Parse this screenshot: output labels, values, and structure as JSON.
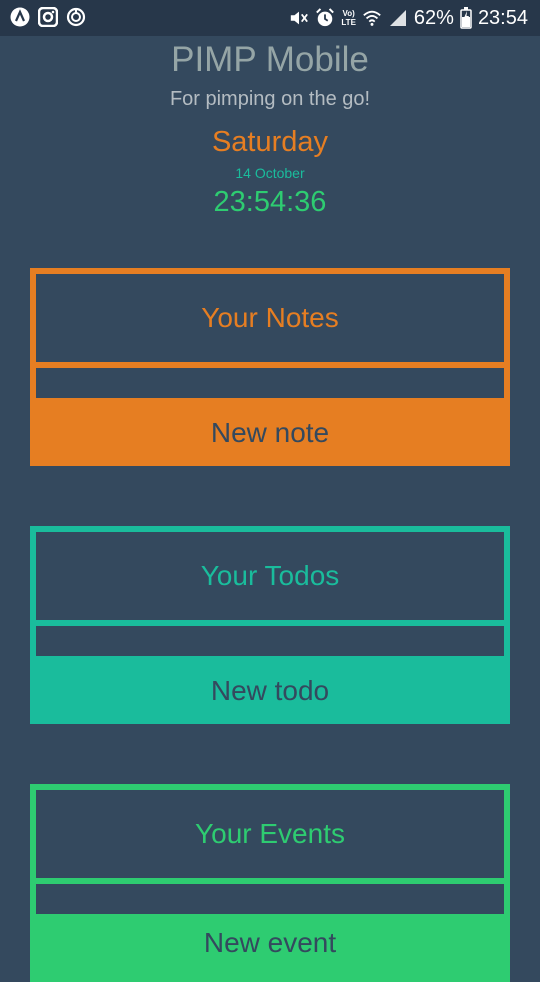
{
  "status_bar": {
    "battery": "62%",
    "clock": "23:54",
    "volte_top": "Vo)",
    "volte_bottom": "LTE",
    "icons": [
      "app-icon",
      "instagram-icon",
      "sync-icon",
      "mute-icon",
      "alarm-icon",
      "volte-icon",
      "wifi-icon",
      "signal-icon",
      "battery-icon"
    ]
  },
  "header": {
    "title": "PIMP Mobile",
    "subtitle": "For pimping on the go!",
    "day": "Saturday",
    "date": "14 October",
    "time": "23:54:36"
  },
  "colors": {
    "background": "#34495e",
    "notes": "#e67e22",
    "todos": "#1abc9c",
    "events": "#2ecc71"
  },
  "sections": [
    {
      "title": "Your Notes",
      "button": "New note"
    },
    {
      "title": "Your Todos",
      "button": "New todo"
    },
    {
      "title": "Your Events",
      "button": "New event"
    }
  ]
}
